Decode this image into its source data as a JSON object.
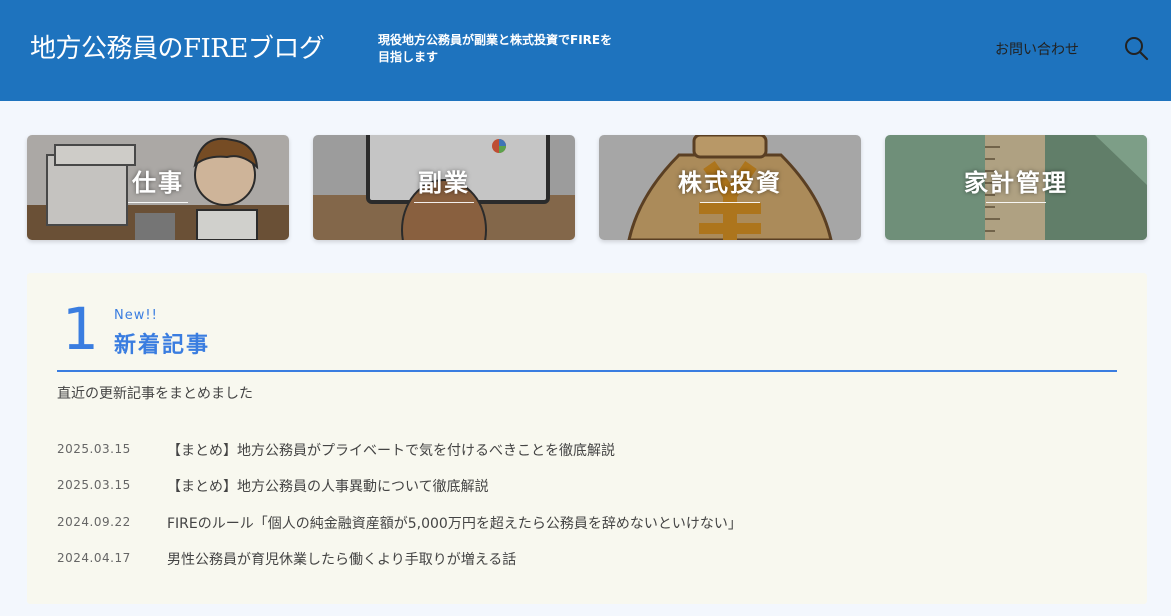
{
  "header": {
    "site_title": "地方公務員のFIREブログ",
    "tagline": "現役地方公務員が副業と株式投資でFIREを目指します",
    "contact_label": "お問い合わせ",
    "search_icon": "search-icon",
    "background_color": "#1e73be"
  },
  "categories": [
    {
      "label": "仕事"
    },
    {
      "label": "副業"
    },
    {
      "label": "株式投資"
    },
    {
      "label": "家計管理"
    }
  ],
  "new_posts": {
    "number": "1",
    "label_en": "New!!",
    "title": "新着記事",
    "description": "直近の更新記事をまとめました",
    "accent_color": "#3a7de0",
    "posts": [
      {
        "date": "2025.03.15",
        "title": "【まとめ】地方公務員がプライベートで気を付けるべきことを徹底解説"
      },
      {
        "date": "2025.03.15",
        "title": "【まとめ】地方公務員の人事異動について徹底解説"
      },
      {
        "date": "2024.09.22",
        "title": "FIREのルール「個人の純金融資産額が5,000万円を超えたら公務員を辞めないといけない」"
      },
      {
        "date": "2024.04.17",
        "title": "男性公務員が育児休業したら働くより手取りが増える話"
      }
    ]
  }
}
